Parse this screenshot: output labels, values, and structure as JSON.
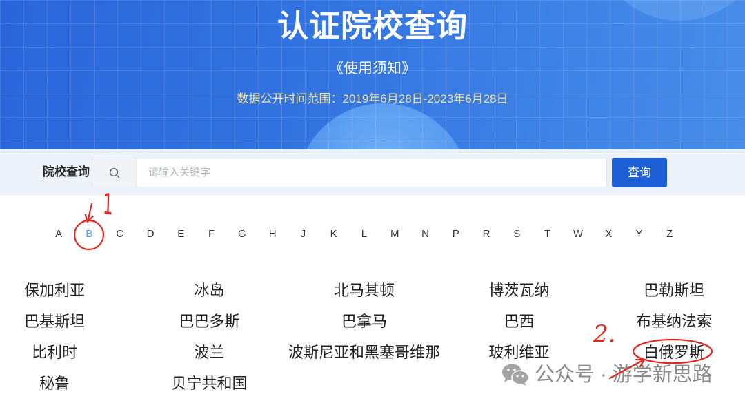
{
  "banner": {
    "title": "认证院校查询",
    "notice_link": "《使用须知》",
    "date_range": "数据公开时间范围：2019年6月28日-2023年6月28日"
  },
  "search": {
    "label": "院校查询",
    "icon": "search-icon",
    "placeholder": "请输入关键字",
    "value": "",
    "button_label": "查询"
  },
  "alphabet": {
    "letters": [
      {
        "letter": "A"
      },
      {
        "letter": "B",
        "active": true
      },
      {
        "letter": "C"
      },
      {
        "letter": "D"
      },
      {
        "letter": "E"
      },
      {
        "letter": "F"
      },
      {
        "letter": "G"
      },
      {
        "letter": "H"
      },
      {
        "letter": "J"
      },
      {
        "letter": "K"
      },
      {
        "letter": "L"
      },
      {
        "letter": "M"
      },
      {
        "letter": "N"
      },
      {
        "letter": "P"
      },
      {
        "letter": "R"
      },
      {
        "letter": "S"
      },
      {
        "letter": "T"
      },
      {
        "letter": "W"
      },
      {
        "letter": "X"
      },
      {
        "letter": "Y"
      },
      {
        "letter": "Z"
      }
    ]
  },
  "countries": [
    {
      "name": "保加利亚"
    },
    {
      "name": "冰岛"
    },
    {
      "name": "北马其顿"
    },
    {
      "name": "博茨瓦纳"
    },
    {
      "name": "巴勒斯坦"
    },
    {
      "name": "巴基斯坦"
    },
    {
      "name": "巴巴多斯"
    },
    {
      "name": "巴拿马"
    },
    {
      "name": "巴西"
    },
    {
      "name": "布基纳法索"
    },
    {
      "name": "比利时"
    },
    {
      "name": "波兰"
    },
    {
      "name": "波斯尼亚和黑塞哥维那"
    },
    {
      "name": "玻利维亚"
    },
    {
      "name": "白俄罗斯"
    },
    {
      "name": "秘鲁"
    },
    {
      "name": "贝宁共和国"
    }
  ],
  "annotations": {
    "step_1": "1",
    "step_2": "2."
  },
  "watermark": {
    "icon": "wechat-icon",
    "text": "公众号 · 游学新思路"
  },
  "colors": {
    "accent": "#1d5fd6",
    "active_letter": "#5b9df0",
    "date_text": "#f4e3a3",
    "annotation": "#e42520"
  }
}
